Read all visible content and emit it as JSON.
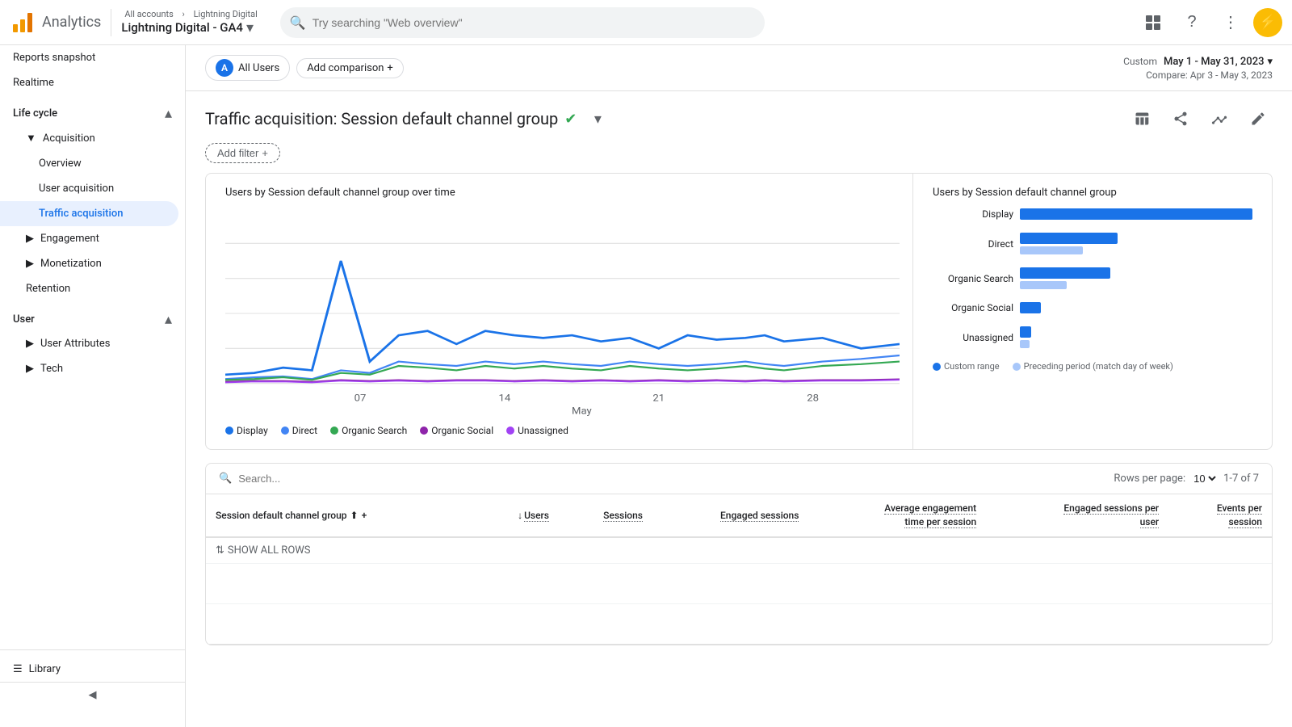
{
  "header": {
    "logo_text": "Analytics",
    "breadcrumb_top": "All accounts > Lightning Digital",
    "account_name": "Lightning Digital - GA4",
    "search_placeholder": "Try searching \"Web overview\"",
    "icons": [
      "grid",
      "help",
      "more_vert",
      "bolt"
    ]
  },
  "sidebar": {
    "sections": [
      {
        "label": "Reports snapshot",
        "type": "item",
        "level": 0
      },
      {
        "label": "Realtime",
        "type": "item",
        "level": 0
      },
      {
        "label": "Life cycle",
        "type": "section-header",
        "expanded": true
      },
      {
        "label": "Acquisition",
        "type": "group",
        "expanded": true,
        "children": [
          {
            "label": "Overview",
            "active": false
          },
          {
            "label": "User acquisition",
            "active": false
          },
          {
            "label": "Traffic acquisition",
            "active": true
          }
        ]
      },
      {
        "label": "Engagement",
        "type": "group",
        "expanded": false,
        "children": []
      },
      {
        "label": "Monetization",
        "type": "group",
        "expanded": false,
        "children": []
      },
      {
        "label": "Retention",
        "type": "item",
        "level": 1
      }
    ],
    "user_section": {
      "label": "User",
      "expanded": true,
      "items": [
        {
          "label": "User Attributes",
          "expanded": false
        },
        {
          "label": "Tech",
          "expanded": false
        }
      ]
    },
    "library_label": "Library",
    "collapse_label": "Collapse"
  },
  "toolbar": {
    "user_segment": "All Users",
    "add_comparison": "Add comparison",
    "date_custom_label": "Custom",
    "date_value": "May 1 - May 31, 2023",
    "date_compare": "Compare: Apr 3 - May 3, 2023"
  },
  "report": {
    "title": "Traffic acquisition: Session default channel group",
    "add_filter": "Add filter",
    "icons": [
      "table_chart",
      "share",
      "insights",
      "edit"
    ]
  },
  "line_chart": {
    "title": "Users by Session default channel group over time",
    "x_labels": [
      "07",
      "14",
      "21",
      "28"
    ],
    "x_sub_label": "May",
    "legend": [
      {
        "label": "Display",
        "color": "#1a73e8"
      },
      {
        "label": "Direct",
        "color": "#4285f4"
      },
      {
        "label": "Organic Search",
        "color": "#34a853"
      },
      {
        "label": "Organic Social",
        "color": "#8e24aa"
      },
      {
        "label": "Unassigned",
        "color": "#a142f4"
      }
    ]
  },
  "bar_chart": {
    "title": "Users by Session default channel group",
    "rows": [
      {
        "label": "Display",
        "primary": 1.0,
        "secondary": 0
      },
      {
        "label": "Direct",
        "primary": 0.42,
        "secondary": 0.27
      },
      {
        "label": "Organic Search",
        "primary": 0.39,
        "secondary": 0.2
      },
      {
        "label": "Organic Social",
        "primary": 0.09,
        "secondary": 0
      },
      {
        "label": "Unassigned",
        "primary": 0.05,
        "secondary": 0.04
      }
    ],
    "legend": [
      {
        "label": "Custom range",
        "color": "#1a73e8"
      },
      {
        "label": "Preceding period (match day of week)",
        "color": "#a8c7fa"
      }
    ]
  },
  "table": {
    "search_placeholder": "Search...",
    "rows_per_page_label": "Rows per page:",
    "rows_per_page_value": "10",
    "pagination": "1-7 of 7",
    "show_all_rows": "SHOW ALL ROWS",
    "columns": [
      {
        "label": "Session default channel group",
        "sortable": true,
        "sub": ""
      },
      {
        "label": "Users",
        "sortable": true,
        "sub": ""
      },
      {
        "label": "Sessions",
        "sortable": false,
        "sub": ""
      },
      {
        "label": "Engaged sessions",
        "sortable": false,
        "sub": ""
      },
      {
        "label": "Average engagement time per session",
        "sortable": false,
        "sub": ""
      },
      {
        "label": "Engaged sessions per user",
        "sortable": false,
        "sub": ""
      },
      {
        "label": "Events per session",
        "sortable": false,
        "sub": ""
      }
    ],
    "rows": []
  }
}
